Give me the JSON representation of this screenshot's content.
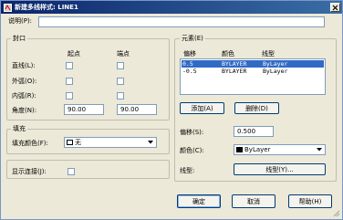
{
  "window": {
    "title": "新建多线样式: LINE1"
  },
  "description": {
    "label": "说明(P):",
    "value": ""
  },
  "caps": {
    "group_title": "封口",
    "col_start": "起点",
    "col_end": "端点",
    "rows": [
      {
        "label": "直线(L):",
        "start": false,
        "end": false
      },
      {
        "label": "外弧(O):",
        "start": false,
        "end": false
      },
      {
        "label": "内弧(R):",
        "start": false,
        "end": false
      }
    ],
    "angle_label": "角度(N):",
    "angle_start": "90.00",
    "angle_end": "90.00"
  },
  "fill": {
    "group_title": "填充",
    "color_label": "填充颜色(F):",
    "color_value": "无"
  },
  "joints": {
    "label": "显示连接(J):",
    "checked": false
  },
  "elements": {
    "group_title": "元素(E)",
    "columns": [
      "偏移",
      "颜色",
      "线型"
    ],
    "rows": [
      {
        "offset": "0.5",
        "color": "BYLAYER",
        "linetype": "ByLayer",
        "selected": true
      },
      {
        "offset": "-0.5",
        "color": "BYLAYER",
        "linetype": "ByLayer",
        "selected": false
      }
    ],
    "add_button": "添加(A)",
    "delete_button": "删除(D)",
    "offset_label": "偏移(S):",
    "offset_value": "0.500",
    "color_label": "颜色(C):",
    "color_value": "ByLayer",
    "linetype_label": "线型:",
    "linetype_button": "线型(Y)..."
  },
  "footer": {
    "ok": "确定",
    "cancel": "取消",
    "help": "帮助(H)"
  },
  "colors": {
    "title_bar": "#0a246a",
    "selection": "#316ac5",
    "dialog_bg": "#ece9d8"
  }
}
